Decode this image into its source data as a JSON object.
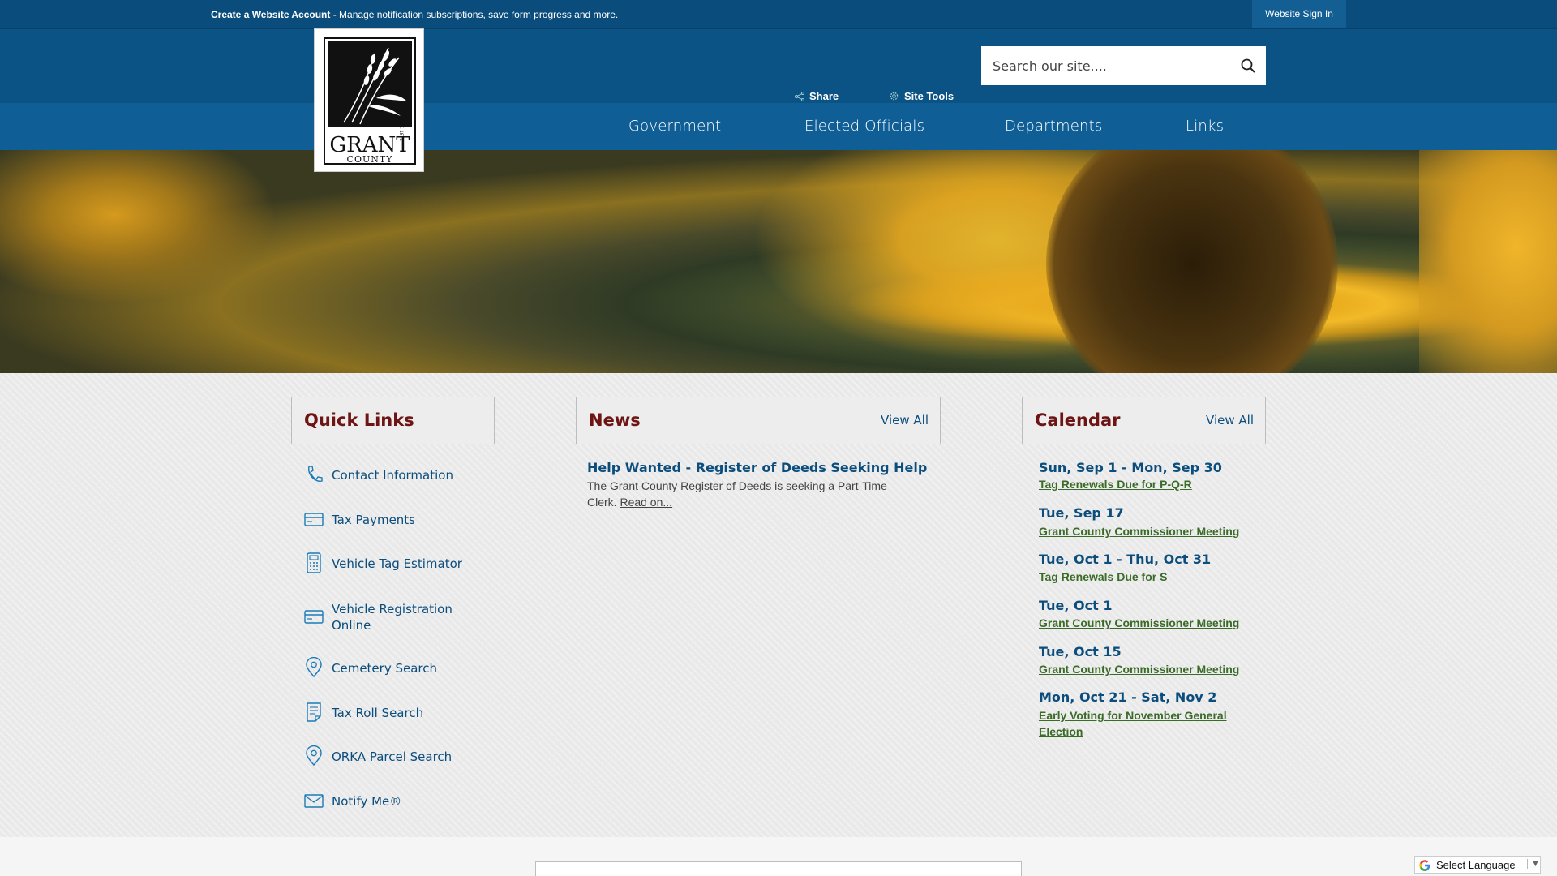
{
  "topbar": {
    "create_account": "Create a Website Account",
    "message": " - Manage notification subscriptions, save form progress and more.",
    "signin": "Website Sign In"
  },
  "logo": {
    "name": "GRANT",
    "sub": "COUNTY",
    "est": "EST. 1873"
  },
  "tools": {
    "share": "Share",
    "site_tools": "Site Tools"
  },
  "search": {
    "placeholder": "Search our site...."
  },
  "nav": [
    "Government",
    "Elected Officials",
    "Departments",
    "Links"
  ],
  "quick_links": {
    "title": "Quick Links",
    "items": [
      {
        "label": "Contact Information",
        "icon": "phone-icon"
      },
      {
        "label": "Tax Payments",
        "icon": "credit-card-icon"
      },
      {
        "label": "Vehicle Tag Estimator",
        "icon": "calculator-icon"
      },
      {
        "label": "Vehicle Registration Online",
        "icon": "credit-card-icon"
      },
      {
        "label": "Cemetery Search",
        "icon": "map-pin-icon"
      },
      {
        "label": "Tax Roll Search",
        "icon": "document-icon"
      },
      {
        "label": "ORKA Parcel Search",
        "icon": "map-pin-icon"
      },
      {
        "label": "Notify Me®",
        "icon": "envelope-icon"
      }
    ]
  },
  "news": {
    "title": "News",
    "view_all": "View All",
    "item_title": "Help Wanted - Register of Deeds Seeking Help",
    "item_body": "The Grant County Register of Deeds is seeking a Part-Time Clerk.",
    "read_on": "Read on..."
  },
  "calendar": {
    "title": "Calendar",
    "view_all": "View All",
    "events": [
      {
        "date": "Sun, Sep 1 - Mon, Sep 30",
        "name": "Tag Renewals Due for P-Q-R"
      },
      {
        "date": "Tue, Sep 17",
        "name": "Grant County Commissioner Meeting"
      },
      {
        "date": "Tue, Oct 1 - Thu, Oct 31",
        "name": "Tag Renewals Due for S"
      },
      {
        "date": "Tue, Oct 1",
        "name": "Grant County Commissioner Meeting"
      },
      {
        "date": "Tue, Oct 15",
        "name": "Grant County Commissioner Meeting"
      },
      {
        "date": "Mon, Oct 21 - Sat, Nov 2",
        "name": "Early Voting for November General Election"
      }
    ]
  },
  "language": {
    "label": "Select Language",
    "arrow": "▼"
  },
  "colors": {
    "topbar": "#0a4d7c",
    "nav": "#0f5f96",
    "heading": "#6d1414",
    "link": "#0b4d7c",
    "event_link": "#3a6b27"
  }
}
